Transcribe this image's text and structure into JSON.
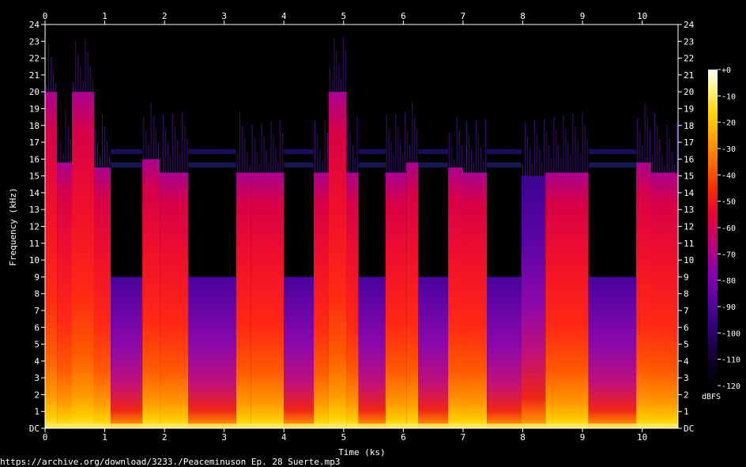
{
  "chart_data": {
    "type": "heatmap",
    "title": "",
    "xlabel": "Time (ks)",
    "ylabel": "Frequency (kHz)",
    "x_ticks": [
      "0",
      "1",
      "2",
      "3",
      "4",
      "5",
      "6",
      "7",
      "8",
      "9",
      "10"
    ],
    "x_tick_values": [
      0,
      1,
      2,
      3,
      4,
      5,
      6,
      7,
      8,
      9,
      10
    ],
    "xlim": [
      0,
      10.6
    ],
    "y_ticks": [
      "DC",
      "1",
      "2",
      "3",
      "4",
      "5",
      "6",
      "7",
      "8",
      "9",
      "10",
      "11",
      "12",
      "13",
      "14",
      "15",
      "16",
      "17",
      "18",
      "19",
      "20",
      "21",
      "22",
      "23",
      "24"
    ],
    "ylim": [
      0,
      24
    ],
    "colorbar": {
      "label": "dBFS",
      "ticks": [
        "+0",
        "-10",
        "-20",
        "-30",
        "-40",
        "-50",
        "-60",
        "-70",
        "-80",
        "-90",
        "-100",
        "-110",
        "-120"
      ],
      "range": [
        -120,
        0
      ],
      "colors": [
        "#000000",
        "#10002a",
        "#2c006e",
        "#5a00a6",
        "#8a00b0",
        "#c0007a",
        "#e8003a",
        "#ff2a00",
        "#ff6800",
        "#ffa000",
        "#ffd400",
        "#fff48a",
        "#ffffff"
      ]
    },
    "segments": [
      {
        "start": 0.0,
        "end": 0.2,
        "type": "loud",
        "cutoff": 20
      },
      {
        "start": 0.2,
        "end": 0.45,
        "type": "loud",
        "cutoff": 15.8
      },
      {
        "start": 0.45,
        "end": 0.82,
        "type": "loud",
        "cutoff": 20
      },
      {
        "start": 0.82,
        "end": 1.1,
        "type": "loud",
        "cutoff": 15.5
      },
      {
        "start": 1.1,
        "end": 1.63,
        "type": "quiet",
        "cutoff": 9
      },
      {
        "start": 1.63,
        "end": 1.92,
        "type": "loud",
        "cutoff": 16
      },
      {
        "start": 1.92,
        "end": 2.4,
        "type": "loud",
        "cutoff": 15.2
      },
      {
        "start": 2.4,
        "end": 3.2,
        "type": "quiet",
        "cutoff": 9
      },
      {
        "start": 3.2,
        "end": 3.45,
        "type": "loud",
        "cutoff": 15.2
      },
      {
        "start": 3.45,
        "end": 4.0,
        "type": "loud",
        "cutoff": 15.2
      },
      {
        "start": 4.0,
        "end": 4.5,
        "type": "quiet",
        "cutoff": 9
      },
      {
        "start": 4.5,
        "end": 4.75,
        "type": "loud",
        "cutoff": 15.2
      },
      {
        "start": 4.75,
        "end": 5.05,
        "type": "loud",
        "cutoff": 20
      },
      {
        "start": 5.05,
        "end": 5.25,
        "type": "loud",
        "cutoff": 15.2
      },
      {
        "start": 5.25,
        "end": 5.7,
        "type": "quiet",
        "cutoff": 9
      },
      {
        "start": 5.7,
        "end": 6.05,
        "type": "loud",
        "cutoff": 15.2
      },
      {
        "start": 6.05,
        "end": 6.25,
        "type": "loud",
        "cutoff": 15.8
      },
      {
        "start": 6.25,
        "end": 6.75,
        "type": "quiet",
        "cutoff": 9
      },
      {
        "start": 6.75,
        "end": 7.0,
        "type": "loud",
        "cutoff": 15.5
      },
      {
        "start": 7.0,
        "end": 7.4,
        "type": "loud",
        "cutoff": 15.2
      },
      {
        "start": 7.4,
        "end": 7.98,
        "type": "quiet",
        "cutoff": 9
      },
      {
        "start": 7.98,
        "end": 8.38,
        "type": "medium",
        "cutoff": 15
      },
      {
        "start": 8.38,
        "end": 9.1,
        "type": "loud",
        "cutoff": 15.2
      },
      {
        "start": 9.1,
        "end": 9.9,
        "type": "quiet",
        "cutoff": 9
      },
      {
        "start": 9.9,
        "end": 10.15,
        "type": "loud",
        "cutoff": 15.8
      },
      {
        "start": 10.15,
        "end": 10.6,
        "type": "loud",
        "cutoff": 15.2
      }
    ]
  },
  "footer": {
    "url": "https://archive.org/download/3233./Peaceminuson Ep. 28 Suerte.mp3"
  }
}
